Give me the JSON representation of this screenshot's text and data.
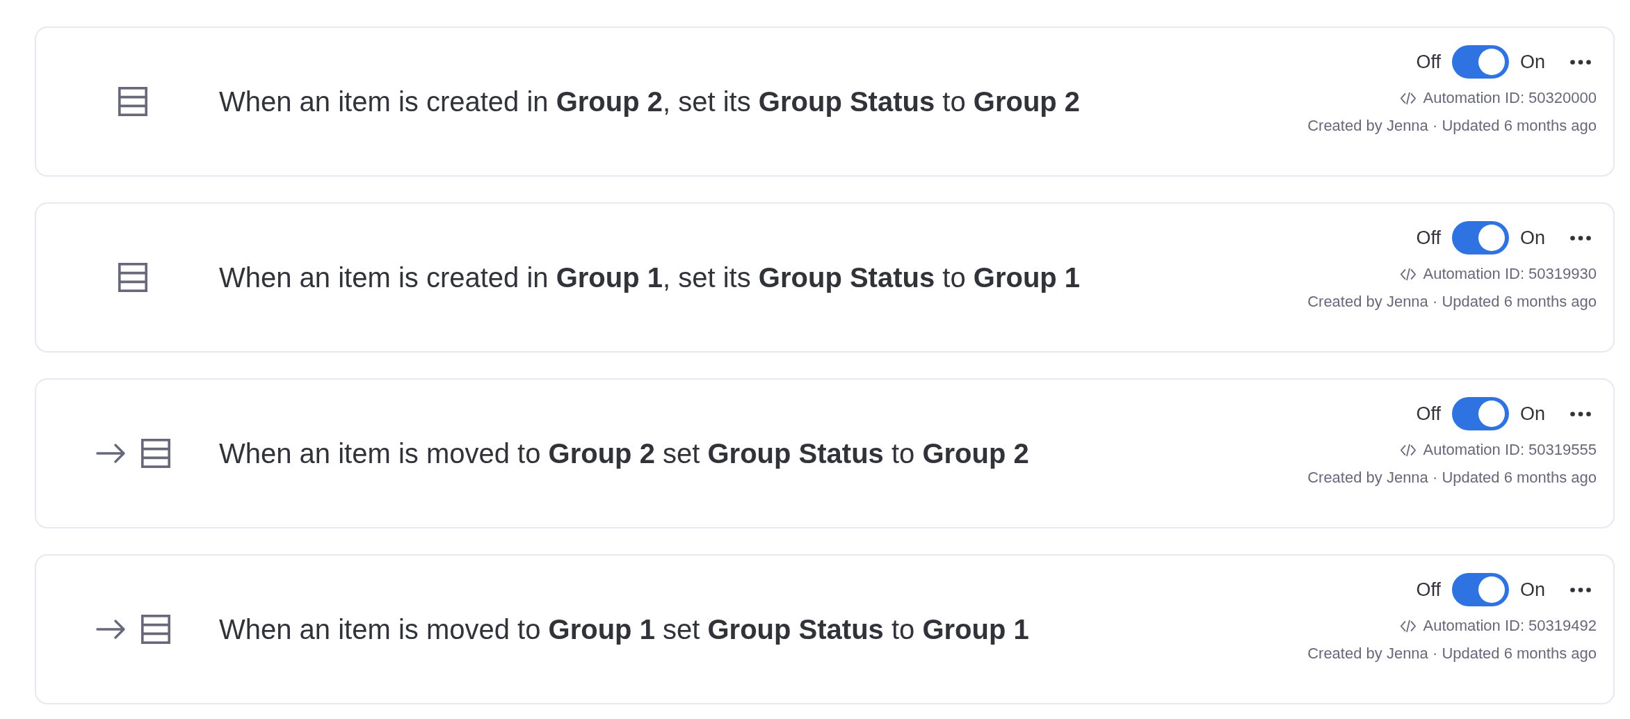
{
  "automations": [
    {
      "kind": "item-created",
      "sentence": "When an item is created in **Group 2**, set its **Group Status** to **Group 2**",
      "off_label": "Off",
      "on": true,
      "on_label": "On",
      "automation_id": "Automation ID: 50320000",
      "meta": "Created by Jenna · Updated 6 months ago"
    },
    {
      "kind": "item-created",
      "sentence": "When an item is created in **Group 1**, set its **Group Status** to **Group 1**",
      "off_label": "Off",
      "on": true,
      "on_label": "On",
      "automation_id": "Automation ID: 50319930",
      "meta": "Created by Jenna · Updated 6 months ago"
    },
    {
      "kind": "item-moved",
      "sentence": "When an item is moved to **Group 2** set **Group Status** to **Group 2**",
      "off_label": "Off",
      "on": true,
      "on_label": "On",
      "automation_id": "Automation ID: 50319555",
      "meta": "Created by Jenna · Updated 6 months ago"
    },
    {
      "kind": "item-moved",
      "sentence": "When an item is moved to **Group 1** set **Group Status** to **Group 1**",
      "off_label": "Off",
      "on": true,
      "on_label": "On",
      "automation_id": "Automation ID: 50319492",
      "meta": "Created by Jenna · Updated 6 months ago"
    }
  ]
}
